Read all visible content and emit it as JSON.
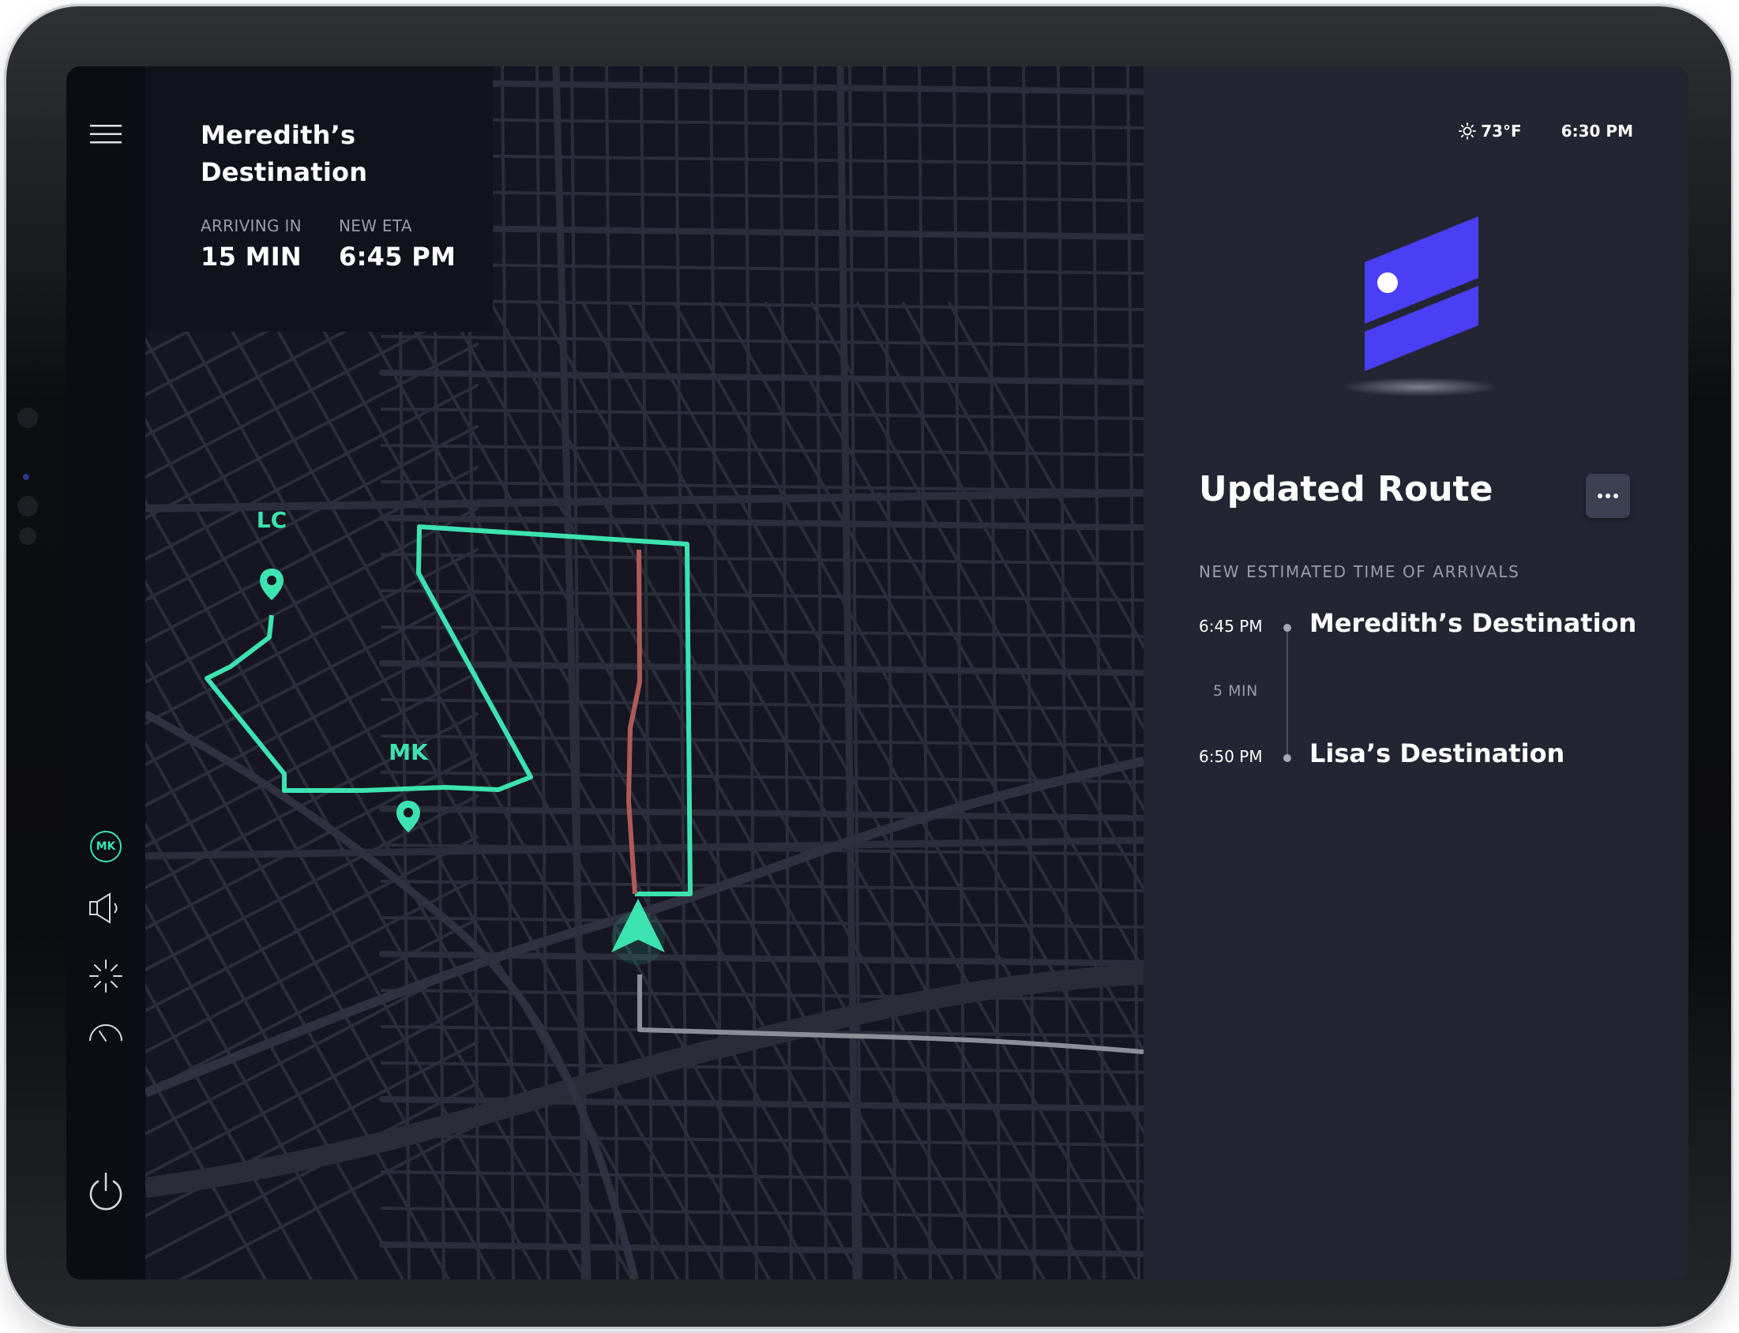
{
  "destination": {
    "title_line1": "Meredith’s",
    "title_line2": "Destination",
    "arriving_label": "ARRIVING IN",
    "arriving_value": "15 MIN",
    "eta_label": "NEW ETA",
    "eta_value": "6:45 PM"
  },
  "map": {
    "pins": [
      {
        "label": "LC"
      },
      {
        "label": "MK"
      }
    ],
    "colors": {
      "route": "#3ce3b0",
      "traffic": "#b05a58",
      "past_route": "#8c8e98",
      "street": "#2b2d3a",
      "background": "#151622"
    }
  },
  "rail": {
    "avatar_initials": "MK",
    "icons": [
      "menu-icon",
      "speaker-icon",
      "brightness-icon",
      "gauge-icon",
      "power-icon"
    ]
  },
  "status": {
    "temperature": "73°F",
    "time": "6:30 PM"
  },
  "panel": {
    "title": "Updated Route",
    "section_label": "NEW ESTIMATED TIME OF ARRIVALS",
    "stops": [
      {
        "time": "6:45 PM",
        "name": "Meredith’s Destination"
      },
      {
        "time": "6:50 PM",
        "name": "Lisa’s Destination"
      }
    ],
    "gap": "5 MIN"
  },
  "accent": "#4a3ff5"
}
